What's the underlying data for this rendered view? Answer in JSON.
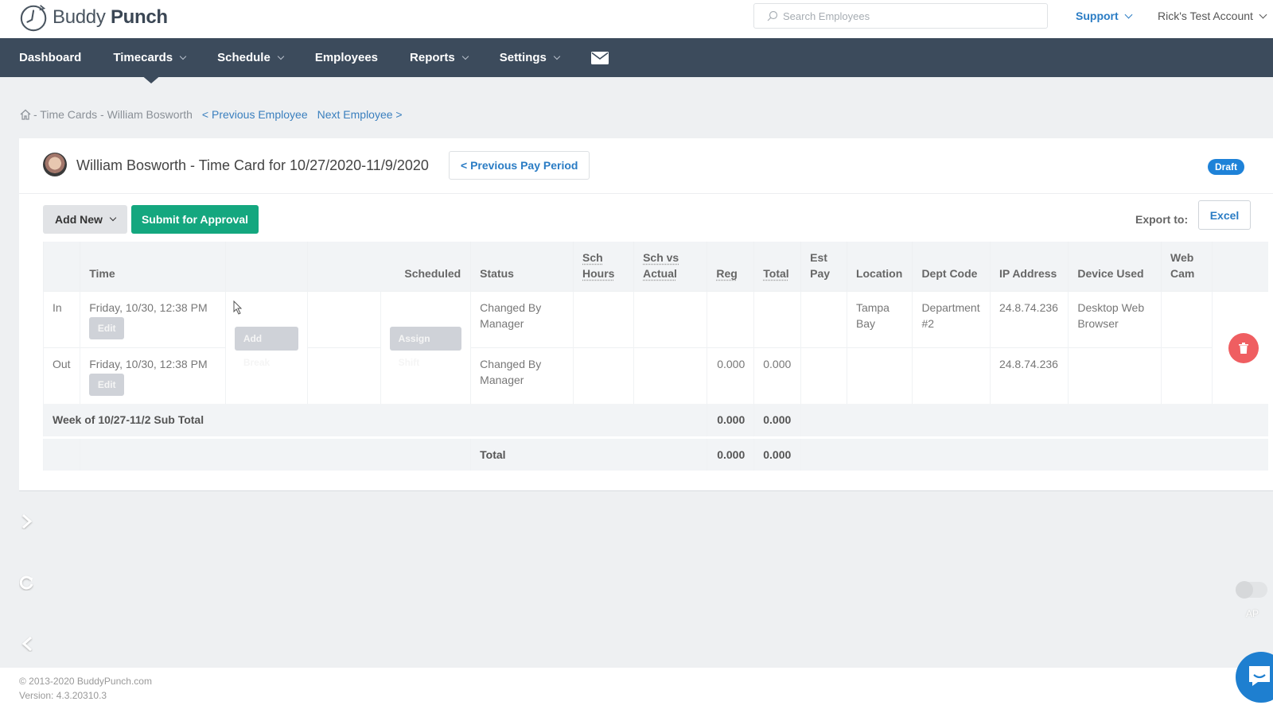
{
  "header": {
    "logo_regular": "Buddy",
    "logo_bold": "Punch",
    "search_placeholder": "Search Employees",
    "support_label": "Support",
    "account_label": "Rick's Test Account"
  },
  "nav": {
    "items": [
      {
        "label": "Dashboard",
        "dropdown": false
      },
      {
        "label": "Timecards",
        "dropdown": true,
        "active": true
      },
      {
        "label": "Schedule",
        "dropdown": true
      },
      {
        "label": "Employees",
        "dropdown": false
      },
      {
        "label": "Reports",
        "dropdown": true
      },
      {
        "label": "Settings",
        "dropdown": true
      }
    ],
    "mail_icon": "envelope-icon"
  },
  "breadcrumb": {
    "path": "- Time Cards - William Bosworth",
    "prev_employee": "< Previous Employee",
    "next_employee": "Next Employee >"
  },
  "card": {
    "title": "William Bosworth - Time Card for 10/27/2020-11/9/2020",
    "prev_period": "< Previous Pay Period",
    "status_badge": "Draft",
    "add_new": "Add New",
    "submit": "Submit for Approval",
    "export_label": "Export to:",
    "excel": "Excel"
  },
  "table": {
    "headers": {
      "time": "Time",
      "scheduled": "Scheduled",
      "status": "Status",
      "sch_hours_1": "Sch",
      "sch_hours_2": "Hours",
      "sch_vs_1": "Sch vs",
      "sch_vs_2": "Actual",
      "reg": "Reg",
      "total": "Total",
      "est_pay_1": "Est",
      "est_pay_2": "Pay",
      "location": "Location",
      "dept_code": "Dept Code",
      "ip": "IP Address",
      "device": "Device Used",
      "webcam_1": "Web",
      "webcam_2": "Cam"
    },
    "rows": [
      {
        "type": "In",
        "time": "Friday, 10/30, 12:38 PM",
        "edit": "Edit",
        "status_1": "Changed By",
        "status_2": "Manager",
        "reg": "",
        "total": "",
        "location_1": "Tampa",
        "location_2": "Bay",
        "dept_1": "Department",
        "dept_2": "#2",
        "ip": "24.8.74.236",
        "device_1": "Desktop Web",
        "device_2": "Browser"
      },
      {
        "type": "Out",
        "time": "Friday, 10/30, 12:38 PM",
        "edit": "Edit",
        "status_1": "Changed By",
        "status_2": "Manager",
        "reg": "0.000",
        "total": "0.000",
        "location_1": "",
        "location_2": "",
        "dept_1": "",
        "dept_2": "",
        "ip": "24.8.74.236",
        "device_1": "",
        "device_2": ""
      }
    ],
    "add_break": "Add Break",
    "assign_shift": "Assign Shift",
    "subtotal": {
      "label": "Week of 10/27-11/2 Sub Total",
      "reg": "0.000",
      "total": "0.000"
    },
    "grand_total": {
      "label": "Total",
      "reg": "0.000",
      "total": "0.000"
    }
  },
  "footer": {
    "copyright": "© 2013-2020 BuddyPunch.com",
    "version": "Version: 4.3.20310.3"
  },
  "widgets": {
    "toggle_label": "AP"
  },
  "colors": {
    "nav_bg": "#3c4b5c",
    "accent_blue": "#2a7cc4",
    "submit_green": "#14a77f",
    "draft_badge": "#1e82d8",
    "delete_red": "#ef5e61"
  }
}
